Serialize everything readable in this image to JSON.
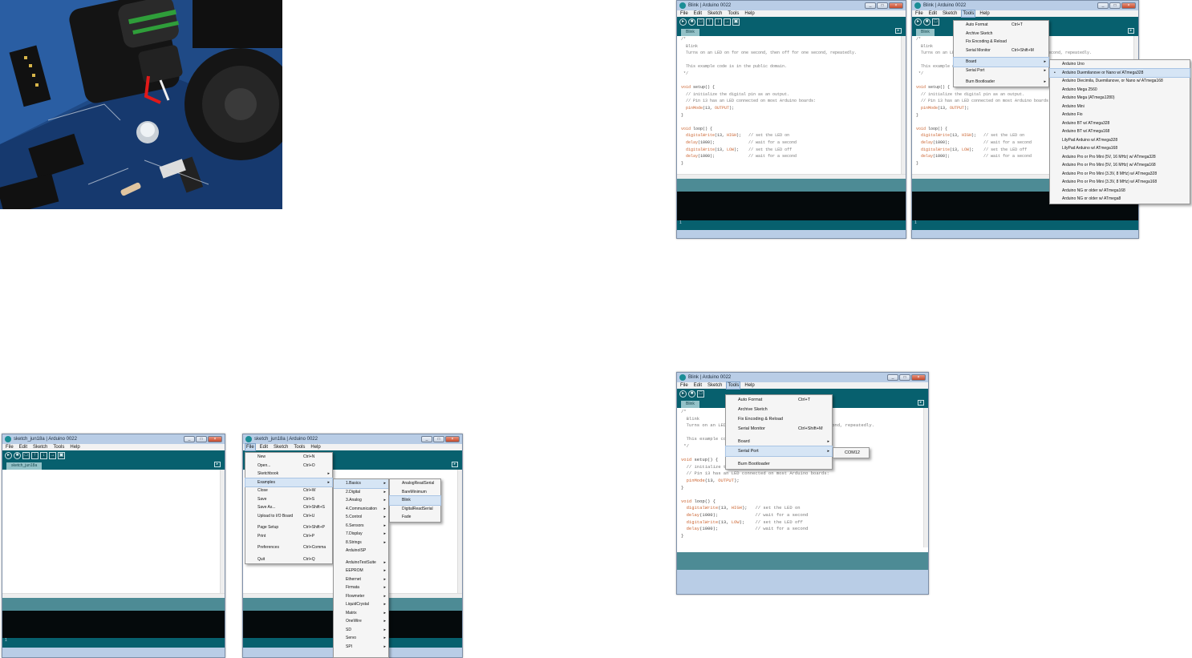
{
  "photo": {
    "caption": ""
  },
  "window_a": {
    "title": "sketch_jun18a | Arduino 0022",
    "menus": [
      "File",
      "Edit",
      "Sketch",
      "Tools",
      "Help"
    ],
    "tab": "sketch_jun18a",
    "line": "1"
  },
  "window_b": {
    "title": "sketch_jun18a | Arduino 0022",
    "menus": [
      "File",
      "Edit",
      "Sketch",
      "Tools",
      "Help"
    ],
    "file_menu": [
      {
        "label": "New",
        "shortcut": "Ctrl+N"
      },
      {
        "label": "Open...",
        "shortcut": "Ctrl+O"
      },
      {
        "label": "Sketchbook",
        "shortcut": ""
      },
      {
        "label": "Examples",
        "shortcut": ""
      },
      {
        "label": "Close",
        "shortcut": "Ctrl+W"
      },
      {
        "label": "Save",
        "shortcut": "Ctrl+S"
      },
      {
        "label": "Save As...",
        "shortcut": "Ctrl+Shift+S"
      },
      {
        "label": "Upload to I/O Board",
        "shortcut": "Ctrl+U"
      },
      {
        "label": "Page Setup",
        "shortcut": "Ctrl+Shift+P"
      },
      {
        "label": "Print",
        "shortcut": "Ctrl+P"
      },
      {
        "label": "Preferences",
        "shortcut": "Ctrl+Comma"
      },
      {
        "label": "Quit",
        "shortcut": "Ctrl+Q"
      }
    ],
    "examples_menu": [
      "1.Basics",
      "2.Digital",
      "3.Analog",
      "4.Communication",
      "5.Control",
      "6.Sensors",
      "7.Display",
      "8.Strings",
      "ArduinoISP",
      "ArduinoTestSuite",
      "EEPROM",
      "Ethernet",
      "Firmata",
      "Flowmeter",
      "LiquidCrystal",
      "Matrix",
      "OneWire",
      "SD",
      "Servo",
      "SPI"
    ],
    "basics_menu": [
      "AnalogReadSerial",
      "BareMinimum",
      "Blink",
      "DigitalReadSerial",
      "Fade"
    ]
  },
  "window_c": {
    "title": "Blink | Arduino 0022",
    "menus": [
      "File",
      "Edit",
      "Sketch",
      "Tools",
      "Help"
    ],
    "tab": "Blink",
    "line": "1"
  },
  "window_d": {
    "title": "Blink | Arduino 0022",
    "menus": [
      "File",
      "Edit",
      "Sketch",
      "Tools",
      "Help"
    ],
    "tab": "Blink",
    "tools_menu": [
      {
        "label": "Auto Format",
        "shortcut": "Ctrl+T"
      },
      {
        "label": "Archive Sketch",
        "shortcut": ""
      },
      {
        "label": "Fix Encoding & Reload",
        "shortcut": ""
      },
      {
        "label": "Serial Monitor",
        "shortcut": "Ctrl+Shift+M"
      },
      {
        "label": "Board",
        "shortcut": ""
      },
      {
        "label": "Serial Port",
        "shortcut": ""
      },
      {
        "label": "Burn Bootloader",
        "shortcut": ""
      }
    ],
    "boards": [
      "Arduino Uno",
      "Arduino Duemilanove or Nano w/ ATmega328",
      "Arduino Diecimila, Duemilanove, or Nano w/ ATmega168",
      "Arduino Mega 2560",
      "Arduino Mega (ATmega1280)",
      "Arduino Mini",
      "Arduino Fio",
      "Arduino BT w/ ATmega328",
      "Arduino BT w/ ATmega168",
      "LilyPad Arduino w/ ATmega328",
      "LilyPad Arduino w/ ATmega168",
      "Arduino Pro or Pro Mini (5V, 16 MHz) w/ ATmega328",
      "Arduino Pro or Pro Mini (5V, 16 MHz) w/ ATmega168",
      "Arduino Pro or Pro Mini (3.3V, 8 MHz) w/ ATmega328",
      "Arduino Pro or Pro Mini (3.3V, 8 MHz) w/ ATmega168",
      "Arduino NG or older w/ ATmega168",
      "Arduino NG or older w/ ATmega8"
    ],
    "line": "1"
  },
  "window_e": {
    "title": "Blink | Arduino 0022",
    "menus": [
      "File",
      "Edit",
      "Sketch",
      "Tools",
      "Help"
    ],
    "tab": "Blink",
    "tools_menu": [
      {
        "label": "Auto Format",
        "shortcut": "Ctrl+T"
      },
      {
        "label": "Archive Sketch",
        "shortcut": ""
      },
      {
        "label": "Fix Encoding & Reload",
        "shortcut": ""
      },
      {
        "label": "Serial Monitor",
        "shortcut": "Ctrl+Shift+M"
      },
      {
        "label": "Board",
        "shortcut": ""
      },
      {
        "label": "Serial Port",
        "shortcut": ""
      },
      {
        "label": "Burn Bootloader",
        "shortcut": ""
      }
    ],
    "serial_port": "COM12"
  },
  "code": {
    "l1": "/*",
    "l2": "  Blink",
    "l3": "  Turns on an LED on for one second, then off for one second, repeatedly.",
    "l4": "",
    "l5": "  This example code is in the public domain.",
    "l6": " */",
    "l7": "",
    "l8a": "void",
    "l8b": " setup() {",
    "l9": "  // initialize the digital pin as an output.",
    "l10": "  // Pin 13 has an LED connected on most Arduino boards:",
    "l11a": "  pinMode",
    "l11b": "(13, ",
    "l11c": "OUTPUT",
    "l11d": ");",
    "l12": "}",
    "l13": "",
    "l14a": "void",
    "l14b": " loop() {",
    "l15a": "  digitalWrite",
    "l15b": "(13, ",
    "l15c": "HIGH",
    "l15d": ");   ",
    "l15e": "// set the LED on",
    "l16a": "  delay",
    "l16b": "(1000);              ",
    "l16e": "// wait for a second",
    "l17a": "  digitalWrite",
    "l17b": "(13, ",
    "l17c": "LOW",
    "l17d": ");    ",
    "l17e": "// set the LED off",
    "l18a": "  delay",
    "l18b": "(1000);              ",
    "l18e": "// wait for a second",
    "l19": "}"
  }
}
